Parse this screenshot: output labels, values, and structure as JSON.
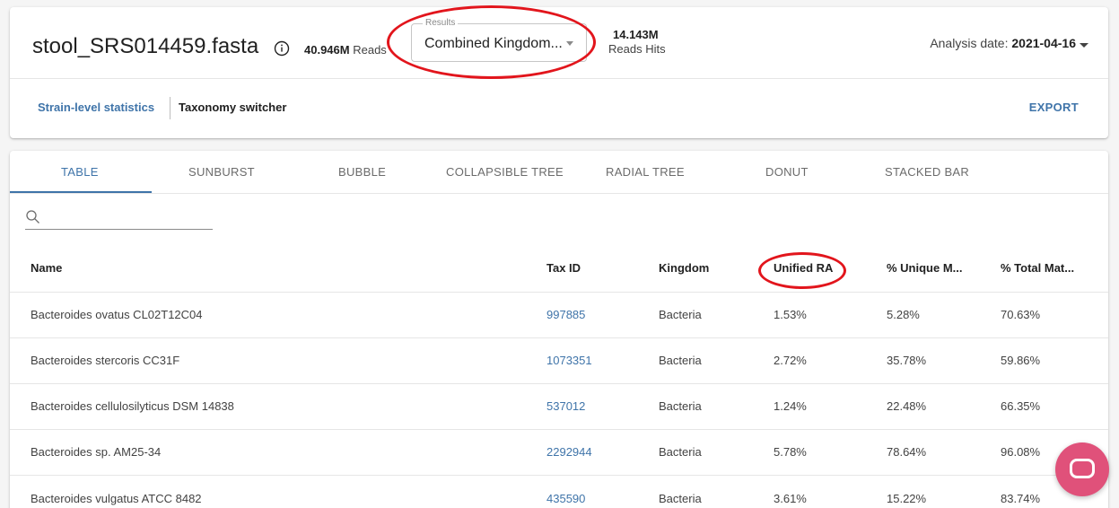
{
  "header": {
    "file_title": "stool_SRS014459.fasta",
    "reads_value": "40.946M",
    "reads_unit": "Reads",
    "results_legend": "Results",
    "results_value": "Combined Kingdom...",
    "hits_value": "14.143M",
    "hits_label": "Reads Hits",
    "analysis_label": "Analysis date:",
    "analysis_date": "2021-04-16"
  },
  "subnav": {
    "strain_link": "Strain-level statistics",
    "taxonomy_switcher": "Taxonomy switcher",
    "export": "EXPORT"
  },
  "tabs": [
    "TABLE",
    "SUNBURST",
    "BUBBLE",
    "COLLAPSIBLE TREE",
    "RADIAL TREE",
    "DONUT",
    "STACKED BAR"
  ],
  "search": {
    "placeholder": ""
  },
  "table": {
    "columns": [
      "Name",
      "Tax ID",
      "Kingdom",
      "Unified RA",
      "% Unique M...",
      "% Total Mat..."
    ],
    "rows": [
      [
        "Bacteroides ovatus CL02T12C04",
        "997885",
        "Bacteria",
        "1.53%",
        "5.28%",
        "70.63%"
      ],
      [
        "Bacteroides stercoris CC31F",
        "1073351",
        "Bacteria",
        "2.72%",
        "35.78%",
        "59.86%"
      ],
      [
        "Bacteroides cellulosilyticus DSM 14838",
        "537012",
        "Bacteria",
        "1.24%",
        "22.48%",
        "66.35%"
      ],
      [
        "Bacteroides sp. AM25-34",
        "2292944",
        "Bacteria",
        "5.78%",
        "78.64%",
        "96.08%"
      ],
      [
        "Bacteroides vulgatus ATCC 8482",
        "435590",
        "Bacteria",
        "3.61%",
        "15.22%",
        "83.74%"
      ]
    ]
  },
  "colors": {
    "accent": "#3f74a9",
    "annotation": "#e2151c",
    "chat": "#e0517a"
  }
}
